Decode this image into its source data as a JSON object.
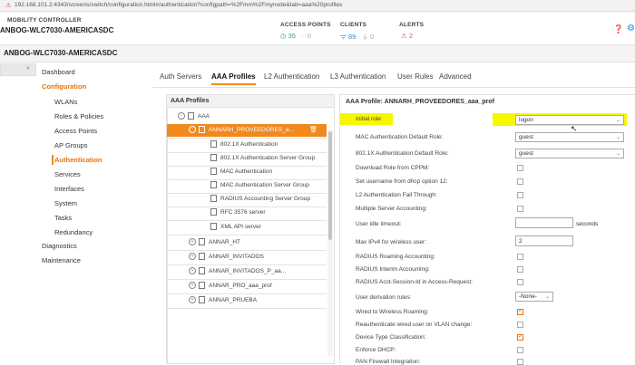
{
  "browser": {
    "url": "192.168.101.2:4343/screens/switch/configuration.html#/authentication?configpath=%2Fmm%2Fmynode&tab=aaa%20profiles",
    "lock_icon": "not-secure-icon"
  },
  "header": {
    "product": "MOBILITY CONTROLLER",
    "device": "ANBOG-WLC7030-AMERICASDC",
    "access_points": {
      "label": "ACCESS POINTS",
      "up": "35",
      "down": "0"
    },
    "clients": {
      "label": "CLIENTS",
      "wireless": "89",
      "wired": "0"
    },
    "alerts": {
      "label": "ALERTS",
      "count": "2"
    }
  },
  "subheader": {
    "title": "ANBOG-WLC7030-AMERICASDC"
  },
  "nav": {
    "dashboard": "Dashboard",
    "configuration": "Configuration",
    "items": [
      "WLANs",
      "Roles & Policies",
      "Access Points",
      "AP Groups",
      "Authentication",
      "Services",
      "Interfaces",
      "System",
      "Tasks",
      "Redundancy"
    ],
    "diagnostics": "Diagnostics",
    "maintenance": "Maintenance"
  },
  "tabs": [
    "Auth Servers",
    "AAA Profiles",
    "L2 Authentication",
    "L3 Authentication",
    "User Rules",
    "Advanced"
  ],
  "left_panel": {
    "title": "AAA Profiles",
    "root": "AAA",
    "selected": "ANNARH_PROVEEDORES_a...",
    "children": [
      "802.1X Authentication",
      "802.1X Authentication Server Group",
      "MAC Authentication",
      "MAC Authentication Server Group",
      "RADIUS Accounting Server Group",
      "RFC 3576 server",
      "XML API server"
    ],
    "siblings": [
      "ANNAR_HT",
      "ANNAR_INVITADOS",
      "ANNAR_INVITADOS_P_aa...",
      "ANNAR_PRO_aaa_prof",
      "ANNAR_PRUEBA"
    ]
  },
  "right_panel": {
    "title": "AAA Profile: ANNARH_PROVEEDORES_aaa_prof",
    "initial_role": {
      "label": "Initial role:",
      "value": "logon"
    },
    "mac_default_role": {
      "label": "MAC Authentication Default Role:",
      "value": "guest"
    },
    "dot1x_default_role": {
      "label": "802.1X Authentication Default Role:",
      "value": "guest"
    },
    "download_role": "Download Role from CPPM:",
    "set_username": "Set username from dhcp option 12:",
    "l2_fallthrough": "L2 Authentication Fall Through:",
    "multiple_accounting": "Multiple Server Accounting:",
    "idle_timeout": {
      "label": "User idle timeout:",
      "value": "",
      "unit": "seconds"
    },
    "max_ipv4": {
      "label": "Max IPv4 for wireless user:",
      "value": "2"
    },
    "radius_roaming": "RADIUS Roaming Accounting:",
    "radius_interim": "RADIUS Interim Accounting:",
    "radius_acct_session": "RADIUS Acct-Session-Id in Access-Request:",
    "user_derivation": {
      "label": "User derivation rules:",
      "value": "-None-"
    },
    "wired_to_wireless": "Wired to Wireless Roaming:",
    "reauth_wired": "Reauthenticate wired user on VLAN change:",
    "device_type": "Device Type Classification:",
    "enforce_dhcp": "Enforce DHCP:",
    "pan_firewall": "PAN Firewall Integration:"
  },
  "colors": {
    "accent": "#f08a1e",
    "highlight": "#f7f700",
    "link": "#2a8ad4"
  }
}
